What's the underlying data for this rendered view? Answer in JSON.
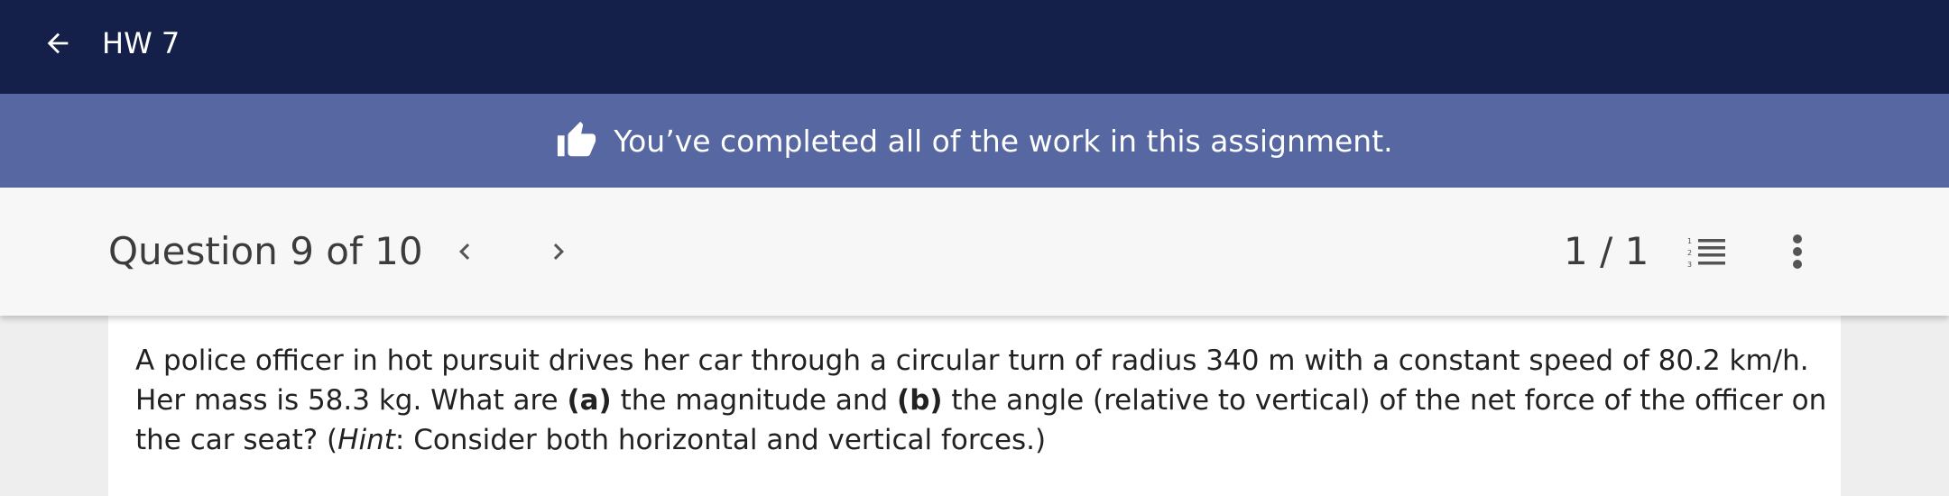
{
  "header": {
    "title": "HW 7",
    "back_icon": "arrow-left-icon"
  },
  "banner": {
    "icon": "thumbs-up-icon",
    "text": "You’ve completed all of the work in this assignment."
  },
  "question_bar": {
    "title": "Question 9 of 10",
    "prev_icon": "chevron-left-icon",
    "next_icon": "chevron-right-icon",
    "score": "1 / 1",
    "list_icon": "numbered-list-icon",
    "more_icon": "more-vertical-icon"
  },
  "question": {
    "part1": "A police officer in hot pursuit drives her car through a circular turn of radius 340 m with a constant speed of 80.2 km/h. Her mass is 58.3 kg. What are ",
    "label_a": "(a)",
    "part2": " the magnitude and ",
    "label_b": "(b)",
    "part3": " the angle (relative to vertical) of the net force of the officer on the car seat? (",
    "hint_label": "Hint",
    "part4": ": Consider both horizontal and vertical forces.)"
  },
  "colors": {
    "topbar": "#141f4a",
    "banner": "#5667a1",
    "question_bar": "#f7f7f7"
  }
}
